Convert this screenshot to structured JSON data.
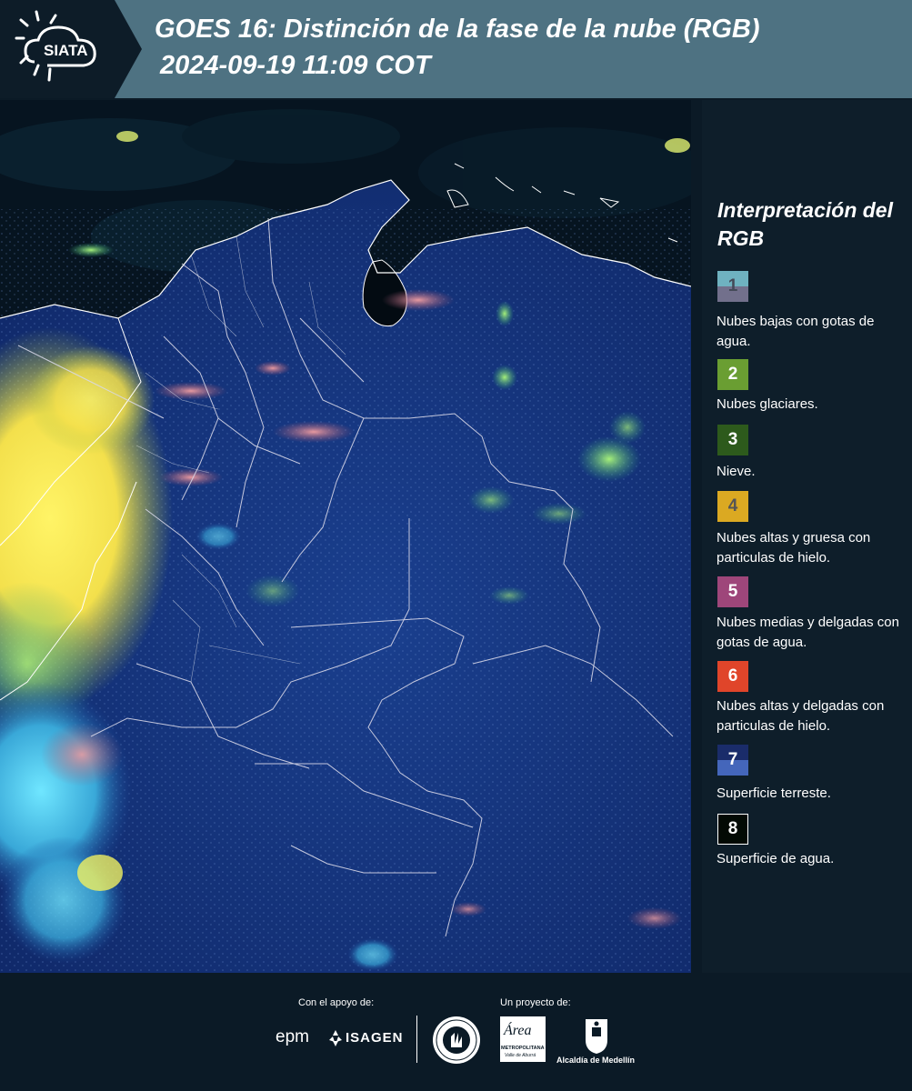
{
  "header": {
    "logo_text": "SIATA",
    "title_line1": "GOES 16: Distinción de la fase de la nube (RGB)",
    "title_line2": "2024-09-19 11:09 COT"
  },
  "legend": {
    "title": "Interpretación del RGB",
    "items": [
      {
        "number": "1",
        "label": "Nubes bajas con gotas de agua.",
        "color_top": "#6fb2c0",
        "color_bottom": "#72708c"
      },
      {
        "number": "2",
        "label": "Nubes glaciares.",
        "color": "#6a9e32"
      },
      {
        "number": "3",
        "label": "Nieve.",
        "color": "#2d5a1c"
      },
      {
        "number": "4",
        "label": "Nubes altas y gruesa con particulas de hielo.",
        "color": "#dba922"
      },
      {
        "number": "5",
        "label": "Nubes medias y delgadas con gotas de agua.",
        "color": "#9e467a"
      },
      {
        "number": "6",
        "label": "Nubes altas y delgadas con particulas de hielo.",
        "color": "#e0452a"
      },
      {
        "number": "7",
        "label": "Superficie terreste.",
        "color_top": "#1a2c6a",
        "color_bottom": "#4466bb"
      },
      {
        "number": "8",
        "label": "Superficie de agua.",
        "color": "#030a04"
      }
    ]
  },
  "footer": {
    "support_label": "Con el apoyo de:",
    "project_label": "Un proyecto de:",
    "partner_epm": "epm",
    "partner_isagen": "ISAGEN",
    "partner_area_line1": "Área",
    "partner_area_line2": "METROPOLITANA",
    "partner_area_line3": "Valle de Aburrá",
    "partner_alcaldia": "Alcaldía de Medellín"
  }
}
